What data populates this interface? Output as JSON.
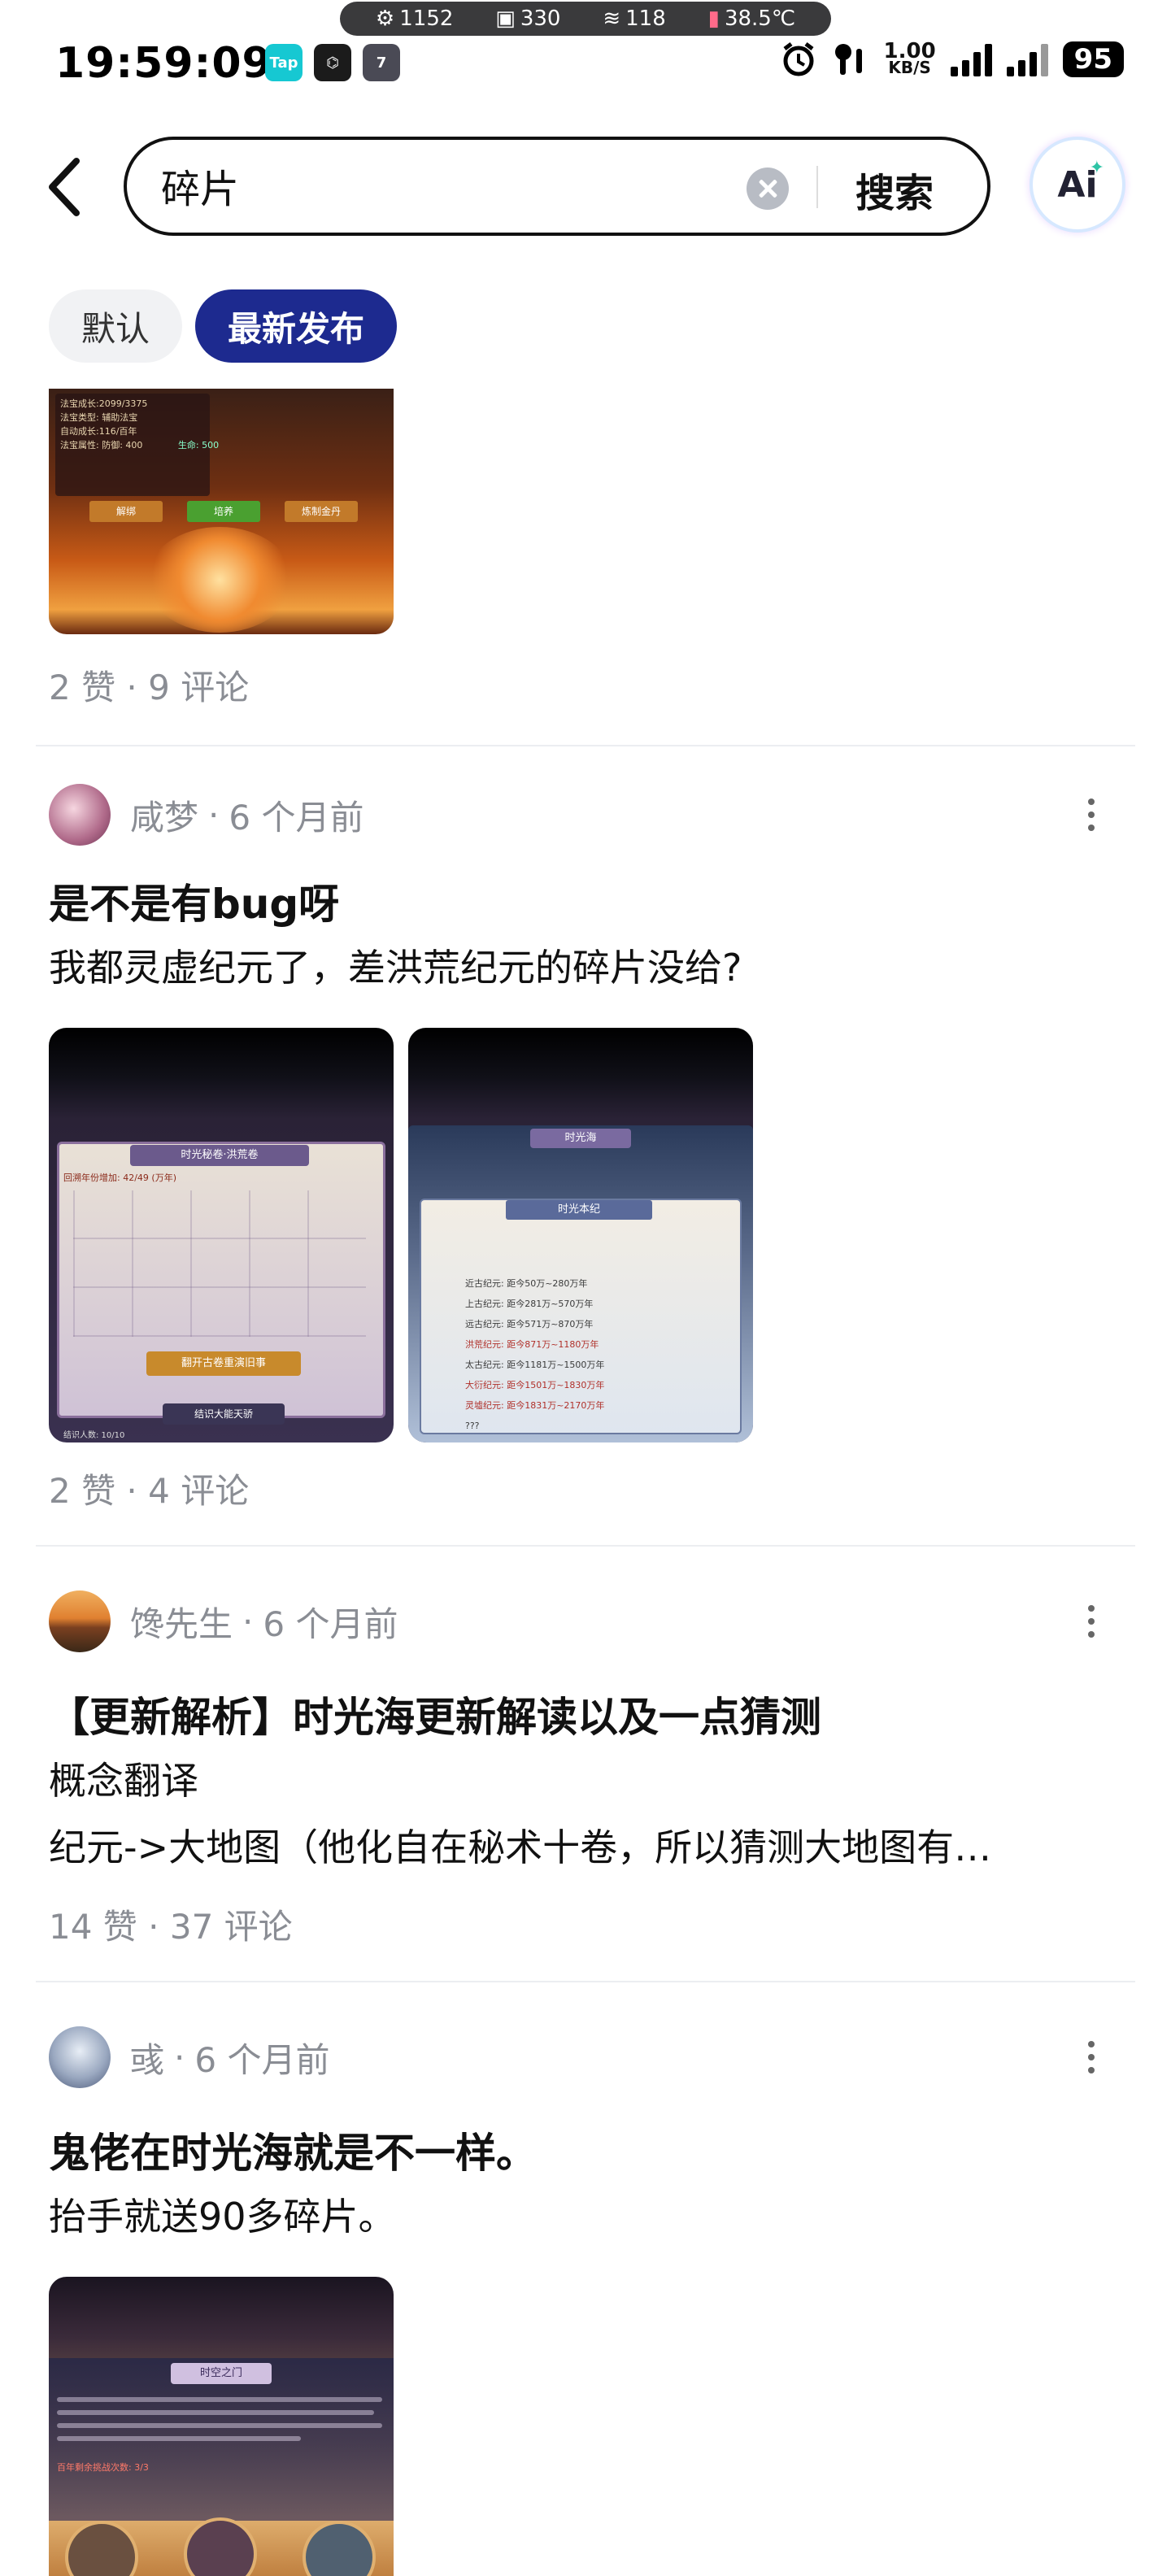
{
  "status_bar": {
    "time": "19:59:09",
    "app_icons": [
      "Tap",
      "⌬",
      "7"
    ],
    "pill": {
      "fps": "1152",
      "mem": "330",
      "freq": "118",
      "temp": "38.5℃"
    },
    "net_speed_value": "1.00",
    "net_speed_unit": "KB/S",
    "battery": "95"
  },
  "search": {
    "query": "碎片",
    "submit_label": "搜索",
    "ai_label": "Ai"
  },
  "filters": {
    "default_label": "默认",
    "latest_label": "最新发布"
  },
  "posts": [
    {
      "stats": "2 赞 · 9 评论",
      "image_text": {
        "l1": "法宝成长:2099/3375",
        "l2": "法宝类型: 辅助法宝",
        "l3": "自动成长:116/百年",
        "l4": "法宝属性: 防御: 400",
        "l4b": "生命: 500",
        "b1": "解绑",
        "b2": "培养",
        "b3": "炼制金丹"
      }
    },
    {
      "author": "咸梦",
      "time": "6 个月前",
      "title": "是不是有bug呀",
      "body": "我都灵虚纪元了，差洪荒纪元的碎片没给?",
      "stats": "2 赞 · 4 评论",
      "image1": {
        "header": "时光秘卷·洪荒卷",
        "sub": "回溯年份增加: 42/49 (万年)",
        "btn": "翻开古卷重演旧事",
        "foot": "结识大能天骄",
        "count": "结识人数: 10/10"
      },
      "image2": {
        "header": "时光海",
        "sub": "时光本纪",
        "rows": [
          "近古纪元: 距今50万~280万年",
          "上古纪元: 距今281万~570万年",
          "远古纪元: 距今571万~870万年",
          "洪荒纪元: 距今871万~1180万年",
          "太古纪元: 距今1181万~1500万年",
          "大衍纪元: 距今1501万~1830万年",
          "灵墟纪元: 距今1831万~2170万年",
          "???"
        ]
      }
    },
    {
      "author": "馋先生",
      "time": "6 个月前",
      "title": "【更新解析】时光海更新解读以及一点猜测",
      "body1": "概念翻译",
      "body2": "纪元->大地图（他化自在秘术十卷，所以猜测大地图有…",
      "stats": "14 赞 · 37 评论"
    },
    {
      "author": "彧",
      "time": "6 个月前",
      "title": "鬼佬在时光海就是不一样。",
      "body": "抬手就送90多碎片。",
      "image": {
        "header": "时空之门",
        "sub": "百年剩余挑战次数: 3/3"
      }
    }
  ]
}
